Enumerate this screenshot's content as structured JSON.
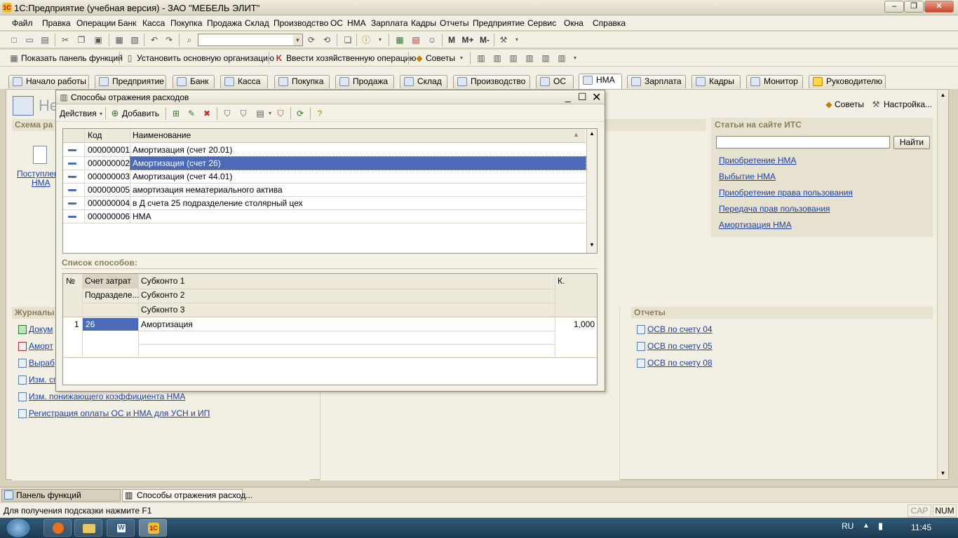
{
  "app": {
    "title": "1С:Предприятие (учебная версия) - ЗАО \"МЕБЕЛЬ ЭЛИТ\""
  },
  "menu": [
    "Файл",
    "Правка",
    "Операции",
    "Банк",
    "Касса",
    "Покупка",
    "Продажа",
    "Склад",
    "Производство",
    "ОС",
    "НМА",
    "Зарплата",
    "Кадры",
    "Отчеты",
    "Предприятие",
    "Сервис",
    "Окна",
    "Справка"
  ],
  "toolbar2": {
    "show_panel": "Показать панель функций",
    "set_org": "Установить основную организацию",
    "enter_op": "Ввести хозяйственную операцию",
    "tips": "Советы"
  },
  "tabs": [
    "Начало работы",
    "Предприятие",
    "Банк",
    "Касса",
    "Покупка",
    "Продажа",
    "Склад",
    "Производство",
    "ОС",
    "НМА",
    "Зарплата",
    "Кадры",
    "Монитор",
    "Руководителю"
  ],
  "panel": {
    "heading": "Не",
    "scheme": "Схема ра",
    "receipt_label1": "Поступлен",
    "receipt_label2": "НМА",
    "tips": "Советы",
    "settings": "Настройка...",
    "its_title": "Статьи на сайте ИТС",
    "find": "Найти",
    "its_links": [
      "Приобретение НМА",
      "Выбытие НМА ",
      "Приобретение права пользования",
      "Передача прав пользования",
      "Амортизация НМА"
    ],
    "journals": "Журналы",
    "journal_links": [
      "Докум",
      "Аморт",
      "Выраб",
      "Изм. сг",
      "Изм. понижающего коэффициента НМА",
      "Регистрация оплаты ОС и НМА для УСН и ИП"
    ],
    "reports": "Отчеты",
    "report_links": [
      "ОСВ по счету 04",
      "ОСВ по счету 05",
      "ОСВ по счету 08"
    ]
  },
  "modal": {
    "title": "Способы отражения расходов",
    "actions": "Действия",
    "add": "Добавить",
    "col_code": "Код",
    "col_name": "Наименование",
    "rows": [
      {
        "code": "000000001",
        "name": "Амортизация (счет 20.01)"
      },
      {
        "code": "000000002",
        "name": "Амортизация (счет 26)"
      },
      {
        "code": "000000003",
        "name": "Амортизация (счет 44.01)"
      },
      {
        "code": "000000005",
        "name": "амортизация нематериального актива"
      },
      {
        "code": "000000004",
        "name": "в Д счета 25 подразделение столярный цех"
      },
      {
        "code": "000000006",
        "name": "НМА"
      }
    ],
    "list_title": "Список способов:",
    "h_num": "№",
    "h_account": "Счет затрат",
    "h_dept": "Подразделе...",
    "h_sub1": "Субконто 1",
    "h_sub2": "Субконто 2",
    "h_sub3": "Субконто 3",
    "h_k": "К.",
    "line": {
      "num": "1",
      "account": "26",
      "sub1": "Амортизация",
      "k": "1,000"
    }
  },
  "wintabs": [
    "Панель функций",
    "Способы отражения расход..."
  ],
  "status": {
    "hint": "Для получения подсказки нажмите F1",
    "cap": "CAP",
    "num": "NUM"
  },
  "taskbar": {
    "lang": "RU",
    "time": "11:45"
  }
}
